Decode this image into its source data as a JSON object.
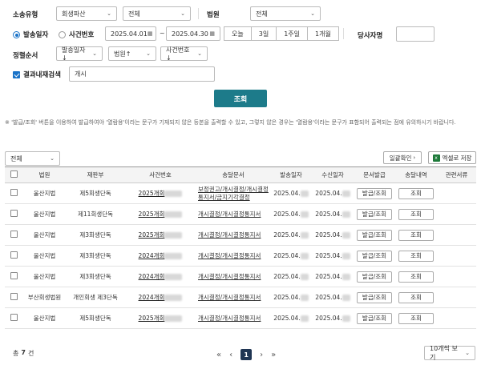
{
  "search": {
    "case_type_label": "소송유형",
    "case_type_value": "회생파산",
    "case_subtype_value": "전체",
    "court_label": "법원",
    "court_value": "전체",
    "date_radio_label": "발송일자",
    "case_radio_label": "사건번호",
    "date_from": "2025.04.01",
    "date_sep": "~",
    "date_to": "2025.04.30",
    "period_buttons": [
      "오늘",
      "3일",
      "1주일",
      "1개월"
    ],
    "party_label": "당사자명",
    "party_value": "",
    "sort_label": "정렬순서",
    "sort1": "발송일자↓",
    "sort2": "법원↑",
    "sort3": "사건번호↓",
    "refine_label": "결과내재검색",
    "refine_value": "개시",
    "search_button": "조회"
  },
  "notice": "※ '발급/조회' 버튼을 이용하여 발급하여야 '열람용'이라는 문구가 기재되지 않은 등본을 출력할 수 있고, 그렇지 않은 경우는 '열람용'이라는 문구가 표함되어 출력되는 점에 유의하시기 바랍니다.",
  "filter_value": "전체",
  "toolbar": {
    "bulk_confirm": "일괄확인",
    "excel_save": "엑셀로 저장"
  },
  "table": {
    "headers": [
      "",
      "법원",
      "재판부",
      "사건번호",
      "송달문서",
      "발송일자",
      "수신일자",
      "문서발급",
      "송달내역",
      "관련서류"
    ],
    "rows": [
      {
        "court": "울산지법",
        "division": "제5회생단독",
        "case_no": "2025개회",
        "doc": "보정권고/개시결정/개시결정통지서/금지기각결정",
        "sent": "2025.04.",
        "recv": "2025.04.",
        "issue": "발급/조회",
        "history": "조회"
      },
      {
        "court": "울산지법",
        "division": "제11회생단독",
        "case_no": "2025개회",
        "doc": "개시결정/개시결정통지서",
        "sent": "2025.04.",
        "recv": "2025.04.",
        "issue": "발급/조회",
        "history": "조회"
      },
      {
        "court": "울산지법",
        "division": "제3회생단독",
        "case_no": "2025개회",
        "doc": "개시결정/개시결정통지서",
        "sent": "2025.04.",
        "recv": "2025.04.",
        "issue": "발급/조회",
        "history": "조회"
      },
      {
        "court": "울산지법",
        "division": "제3회생단독",
        "case_no": "2024개회",
        "doc": "개시결정/개시결정통지서",
        "sent": "2025.04.",
        "recv": "2025.04.",
        "issue": "발급/조회",
        "history": "조회"
      },
      {
        "court": "울산지법",
        "division": "제3회생단독",
        "case_no": "2024개회",
        "doc": "개시결정/개시결정통지서",
        "sent": "2025.04.",
        "recv": "2025.04.",
        "issue": "발급/조회",
        "history": "조회"
      },
      {
        "court": "부산회생법원",
        "division": "개인회생 제3단독",
        "case_no": "2024개회",
        "doc": "개시결정/개시결정통지서",
        "sent": "2025.04.",
        "recv": "2025.04.",
        "issue": "발급/조회",
        "history": "조회"
      },
      {
        "court": "울산지법",
        "division": "제5회생단독",
        "case_no": "2025개회",
        "doc": "개시결정/개시결정통지서",
        "sent": "2025.04.",
        "recv": "2025.04.",
        "issue": "발급/조회",
        "history": "조회"
      }
    ]
  },
  "footer": {
    "total_prefix": "총",
    "total_count": "7",
    "total_suffix": "건",
    "current_page": "1",
    "page_size": "10개씩 보기"
  },
  "colors": {
    "accent": "#1d7b8a",
    "radio_blue": "#1a73c8",
    "page_active": "#1f3553",
    "excel_green": "#1e7a3a"
  }
}
